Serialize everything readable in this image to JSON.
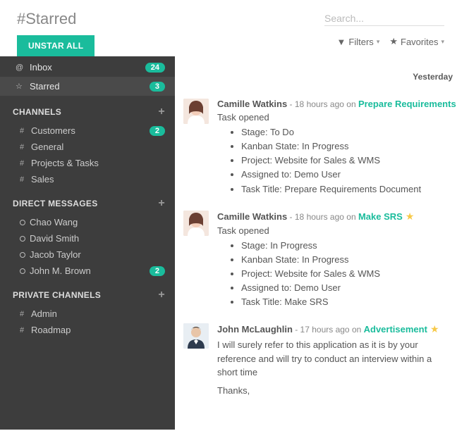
{
  "header": {
    "title": "#Starred",
    "unstar_label": "UNSTAR ALL",
    "search_placeholder": "Search...",
    "filters_label": "Filters",
    "favorites_label": "Favorites"
  },
  "sidebar": {
    "top": [
      {
        "icon": "@",
        "label": "Inbox",
        "badge": "24",
        "active": false
      },
      {
        "icon": "☆",
        "label": "Starred",
        "badge": "3",
        "active": true
      }
    ],
    "sections": [
      {
        "title": "CHANNELS",
        "items": [
          {
            "prefix": "#",
            "label": "Customers",
            "badge": "2"
          },
          {
            "prefix": "#",
            "label": "General"
          },
          {
            "prefix": "#",
            "label": "Projects & Tasks"
          },
          {
            "prefix": "#",
            "label": "Sales"
          }
        ]
      },
      {
        "title": "DIRECT MESSAGES",
        "items": [
          {
            "prefix": "o",
            "label": "Chao Wang"
          },
          {
            "prefix": "o",
            "label": "David Smith"
          },
          {
            "prefix": "o",
            "label": "Jacob Taylor"
          },
          {
            "prefix": "o",
            "label": "John M. Brown",
            "badge": "2"
          }
        ]
      },
      {
        "title": "PRIVATE CHANNELS",
        "items": [
          {
            "prefix": "#",
            "label": "Admin"
          },
          {
            "prefix": "#",
            "label": "Roadmap"
          }
        ]
      }
    ]
  },
  "feed": {
    "day_label": "Yesterday",
    "messages": [
      {
        "author": "Camille Watkins",
        "time": "18 hours ago",
        "on": "on",
        "subject": "Prepare Requirements",
        "starred": false,
        "lead": "Task opened",
        "bullets": [
          "Stage: To Do",
          "Kanban State: In Progress",
          "Project: Website for Sales & WMS",
          "Assigned to: Demo User",
          "Task Title: Prepare Requirements Document"
        ],
        "avatar": "female"
      },
      {
        "author": "Camille Watkins",
        "time": "18 hours ago",
        "on": "on",
        "subject": "Make SRS",
        "starred": true,
        "lead": "Task opened",
        "bullets": [
          "Stage: In Progress",
          "Kanban State: In Progress",
          "Project: Website for Sales & WMS",
          "Assigned to: Demo User",
          "Task Title: Make SRS"
        ],
        "avatar": "female"
      },
      {
        "author": "John McLaughlin",
        "time": "17 hours ago",
        "on": "on",
        "subject": "Advertisement",
        "starred": true,
        "paragraphs": [
          "I will surely refer to this application as it is by your reference and will try to conduct an interview within a short time",
          "Thanks,"
        ],
        "avatar": "male"
      }
    ]
  }
}
